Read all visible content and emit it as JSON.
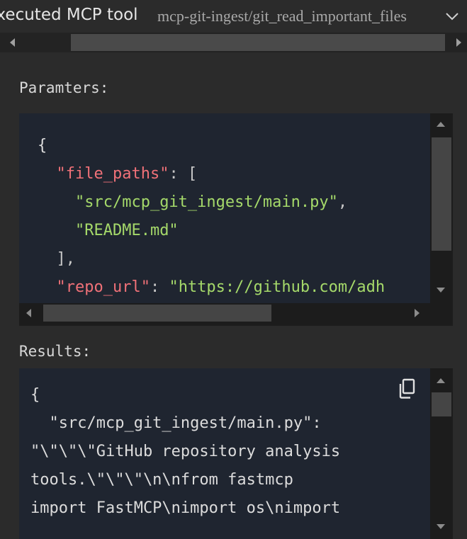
{
  "header": {
    "title": "Executed MCP tool",
    "tool_name": "mcp-git-ingest/git_read_important_files"
  },
  "parameters": {
    "label": "Paramters:",
    "lines": [
      {
        "parts": [
          {
            "t": "{",
            "c": "w"
          }
        ]
      },
      {
        "parts": [
          {
            "t": "  ",
            "c": "w"
          },
          {
            "t": "\"file_paths\"",
            "c": "k"
          },
          {
            "t": ": [",
            "c": "p"
          }
        ]
      },
      {
        "parts": [
          {
            "t": "    ",
            "c": "w"
          },
          {
            "t": "\"src/mcp_git_ingest/main.py\"",
            "c": "s"
          },
          {
            "t": ",",
            "c": "p"
          }
        ]
      },
      {
        "parts": [
          {
            "t": "    ",
            "c": "w"
          },
          {
            "t": "\"README.md\"",
            "c": "s"
          }
        ]
      },
      {
        "parts": [
          {
            "t": "  ],",
            "c": "p"
          }
        ]
      },
      {
        "parts": [
          {
            "t": "  ",
            "c": "w"
          },
          {
            "t": "\"repo_url\"",
            "c": "k"
          },
          {
            "t": ": ",
            "c": "p"
          },
          {
            "t": "\"https://github.com/adh",
            "c": "s"
          }
        ]
      }
    ]
  },
  "results": {
    "label": "Results:",
    "lines": [
      "{",
      "  \"src/mcp_git_ingest/main.py\":",
      "\"\\\"\\\"\\\"GitHub repository analysis",
      "tools.\\\"\\\"\\\"\\n\\nfrom fastmcp",
      "import FastMCP\\nimport os\\nimport"
    ]
  },
  "colors": {
    "key": "#f07178",
    "string": "#a5d96a",
    "panel_bg": "#1f2530"
  }
}
